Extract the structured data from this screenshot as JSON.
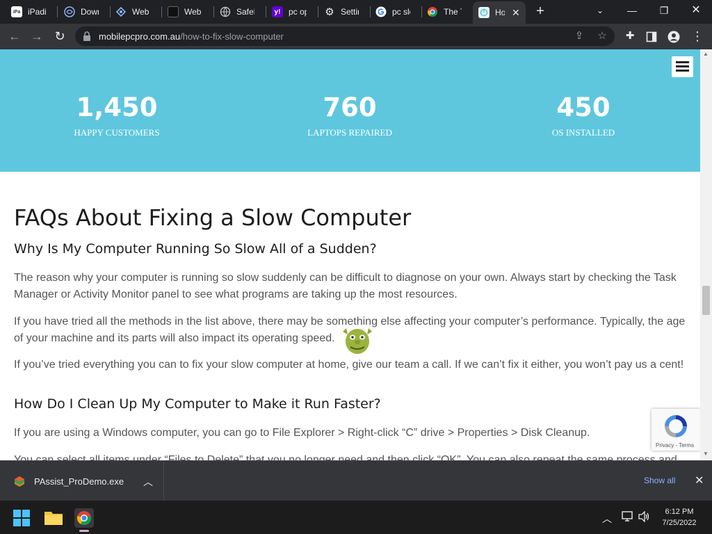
{
  "browser": {
    "tabs": [
      {
        "title": "iPadian",
        "icon": "ipadian-favicon"
      },
      {
        "title": "Downl",
        "icon": "download-favicon"
      },
      {
        "title": "Web S",
        "icon": "websearch-favicon"
      },
      {
        "title": "Web S",
        "icon": "websearch-dark-favicon"
      },
      {
        "title": "SafeFi",
        "icon": "globe-favicon"
      },
      {
        "title": "pc opt",
        "icon": "yahoo-favicon"
      },
      {
        "title": "Settin",
        "icon": "gear-favicon"
      },
      {
        "title": "pc slo",
        "icon": "google-favicon"
      },
      {
        "title": "The To",
        "icon": "chrome-web-favicon"
      },
      {
        "title": "Ho",
        "icon": "mobilepcpro-favicon",
        "active": true
      }
    ],
    "url_host": "mobilepcpro.com.au",
    "url_path": "/how-to-fix-slow-computer"
  },
  "stats": [
    {
      "number": "1,450",
      "label": "HAPPY CUSTOMERS"
    },
    {
      "number": "760",
      "label": "LAPTOPS REPAIRED"
    },
    {
      "number": "450",
      "label": "OS INSTALLED"
    }
  ],
  "article": {
    "heading": "FAQs About Fixing a Slow Computer",
    "q1": "Why Is My Computer Running So Slow All of a Sudden?",
    "p1": "The reason why your computer is running so slow suddenly can be difficult to diagnose on your own. Always start by checking the Task Manager or Activity Monitor panel to see what programs are taking up the most resources.",
    "p2": "If you have tried all the methods in the list above, there may be something else affecting your computer’s performance. Typically, the age of your machine and its parts will also impact its operating speed.",
    "p3": "If you’ve tried everything you can to fix your slow computer at home, give our team a call. If we can’t fix it either, you won’t pay us a cent!",
    "q2": "How Do I Clean Up My Computer to Make it Run Faster?",
    "p4": "If you are using a Windows computer, you can go to File Explorer > Right-click “C” drive > Properties > Disk Cleanup.",
    "p5": "You can select all items under “Files to Delete” that you no longer need and then click “OK”. You can also repeat the same process and"
  },
  "recaptcha": {
    "links": "Privacy - Terms"
  },
  "downloads": {
    "file": "PAssist_ProDemo.exe",
    "show_all": "Show all"
  },
  "taskbar": {
    "time": "6:12 PM",
    "date": "7/25/2022"
  },
  "colors": {
    "accent_band": "#5ec7de",
    "link": "#8ab4f8"
  }
}
